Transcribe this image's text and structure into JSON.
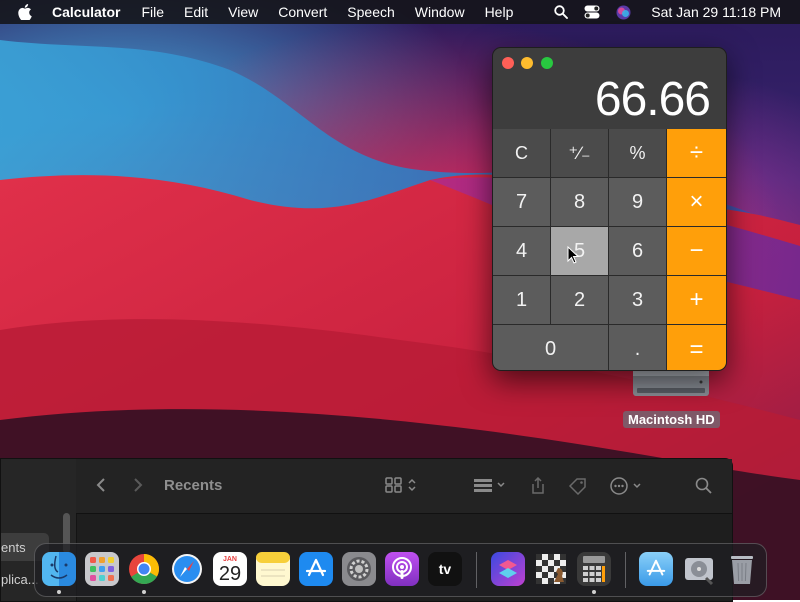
{
  "menubar": {
    "app_name": "Calculator",
    "menus": [
      "File",
      "Edit",
      "View",
      "Convert",
      "Speech",
      "Window",
      "Help"
    ],
    "clock": "Sat Jan 29  11:18 PM"
  },
  "calculator": {
    "display": "66.66",
    "keys": [
      {
        "label": "C",
        "kind": "fn",
        "name": "clear-key"
      },
      {
        "label": "⁺∕₋",
        "kind": "fn",
        "name": "sign-toggle-key"
      },
      {
        "label": "%",
        "kind": "fn",
        "name": "percent-key"
      },
      {
        "label": "÷",
        "kind": "op",
        "name": "divide-key"
      },
      {
        "label": "7",
        "kind": "num",
        "name": "digit-7-key"
      },
      {
        "label": "8",
        "kind": "num",
        "name": "digit-8-key"
      },
      {
        "label": "9",
        "kind": "num",
        "name": "digit-9-key"
      },
      {
        "label": "×",
        "kind": "op",
        "name": "multiply-key"
      },
      {
        "label": "4",
        "kind": "num",
        "name": "digit-4-key"
      },
      {
        "label": "5",
        "kind": "num",
        "name": "digit-5-key",
        "pressed": true
      },
      {
        "label": "6",
        "kind": "num",
        "name": "digit-6-key"
      },
      {
        "label": "−",
        "kind": "op",
        "name": "subtract-key"
      },
      {
        "label": "1",
        "kind": "num",
        "name": "digit-1-key"
      },
      {
        "label": "2",
        "kind": "num",
        "name": "digit-2-key"
      },
      {
        "label": "3",
        "kind": "num",
        "name": "digit-3-key"
      },
      {
        "label": "+",
        "kind": "op",
        "name": "add-key"
      },
      {
        "label": "0",
        "kind": "num",
        "name": "digit-0-key",
        "wide": true
      },
      {
        "label": ".",
        "kind": "num",
        "name": "decimal-key"
      },
      {
        "label": "=",
        "kind": "op",
        "name": "equals-key"
      }
    ]
  },
  "desktop": {
    "drive_label": "Macintosh HD"
  },
  "finder": {
    "title": "Recents",
    "sidebar_items": [
      "ents",
      "plica..."
    ]
  },
  "dock": {
    "apps": [
      "finder",
      "launchpad",
      "chrome",
      "safari",
      "calendar",
      "notes",
      "app-store",
      "system-preferences",
      "podcasts",
      "apple-tv",
      "shortcuts",
      "chess",
      "calculator",
      "applications-folder",
      "disk-utility",
      "trash"
    ],
    "calendar_month": "JAN",
    "calendar_day": "29",
    "tv_label": "tv"
  },
  "colors": {
    "operator": "#ff9f0a",
    "key": "#5c5c5c",
    "function_key": "#4b4b4b",
    "pressed_key": "#a8a8a8"
  }
}
